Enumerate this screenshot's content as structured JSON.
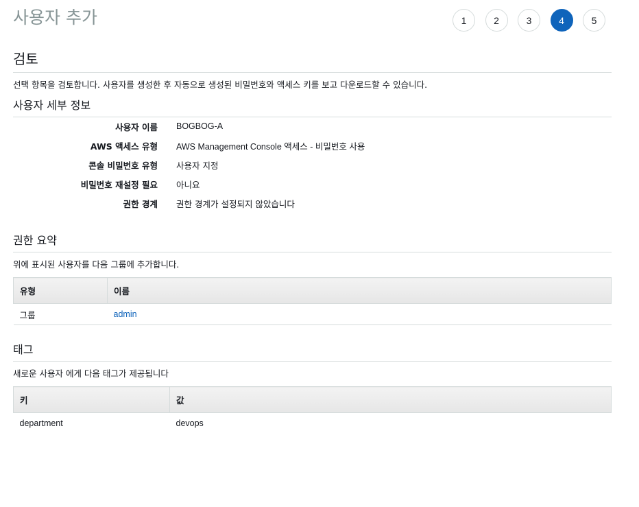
{
  "page_title": "사용자 추가",
  "steps": [
    "1",
    "2",
    "3",
    "4",
    "5"
  ],
  "review": {
    "title": "검토",
    "description": "선택 항목을 검토합니다. 사용자를 생성한 후 자동으로 생성된 비밀번호와 액세스 키를 보고 다운로드할 수 있습니다."
  },
  "user_details": {
    "title": "사용자 세부 정보",
    "rows": [
      {
        "key": "사용자 이름",
        "value": "BOGBOG-A"
      },
      {
        "key": "AWS 액세스 유형",
        "value": "AWS Management Console 액세스 - 비밀번호 사용"
      },
      {
        "key": "콘솔 비밀번호 유형",
        "value": "사용자 지정"
      },
      {
        "key": "비밀번호 재설정 필요",
        "value": "아니요"
      },
      {
        "key": "권한 경계",
        "value": "권한 경계가 설정되지 않았습니다"
      }
    ]
  },
  "permissions": {
    "title": "권한 요약",
    "description": "위에 표시된 사용자를 다음 그룹에 추가합니다.",
    "headers": [
      "유형",
      "이름"
    ],
    "rows": [
      {
        "type": "그룹",
        "name": "admin"
      }
    ]
  },
  "tags": {
    "title": "태그",
    "description": "새로운 사용자 에게 다음 태그가 제공됩니다",
    "headers": [
      "키",
      "값"
    ],
    "rows": [
      {
        "key": "department",
        "value": "devops"
      }
    ]
  },
  "colors": {
    "accent": "#0f64bb",
    "title_gray": "#879596",
    "border": "#d5dbdb"
  }
}
